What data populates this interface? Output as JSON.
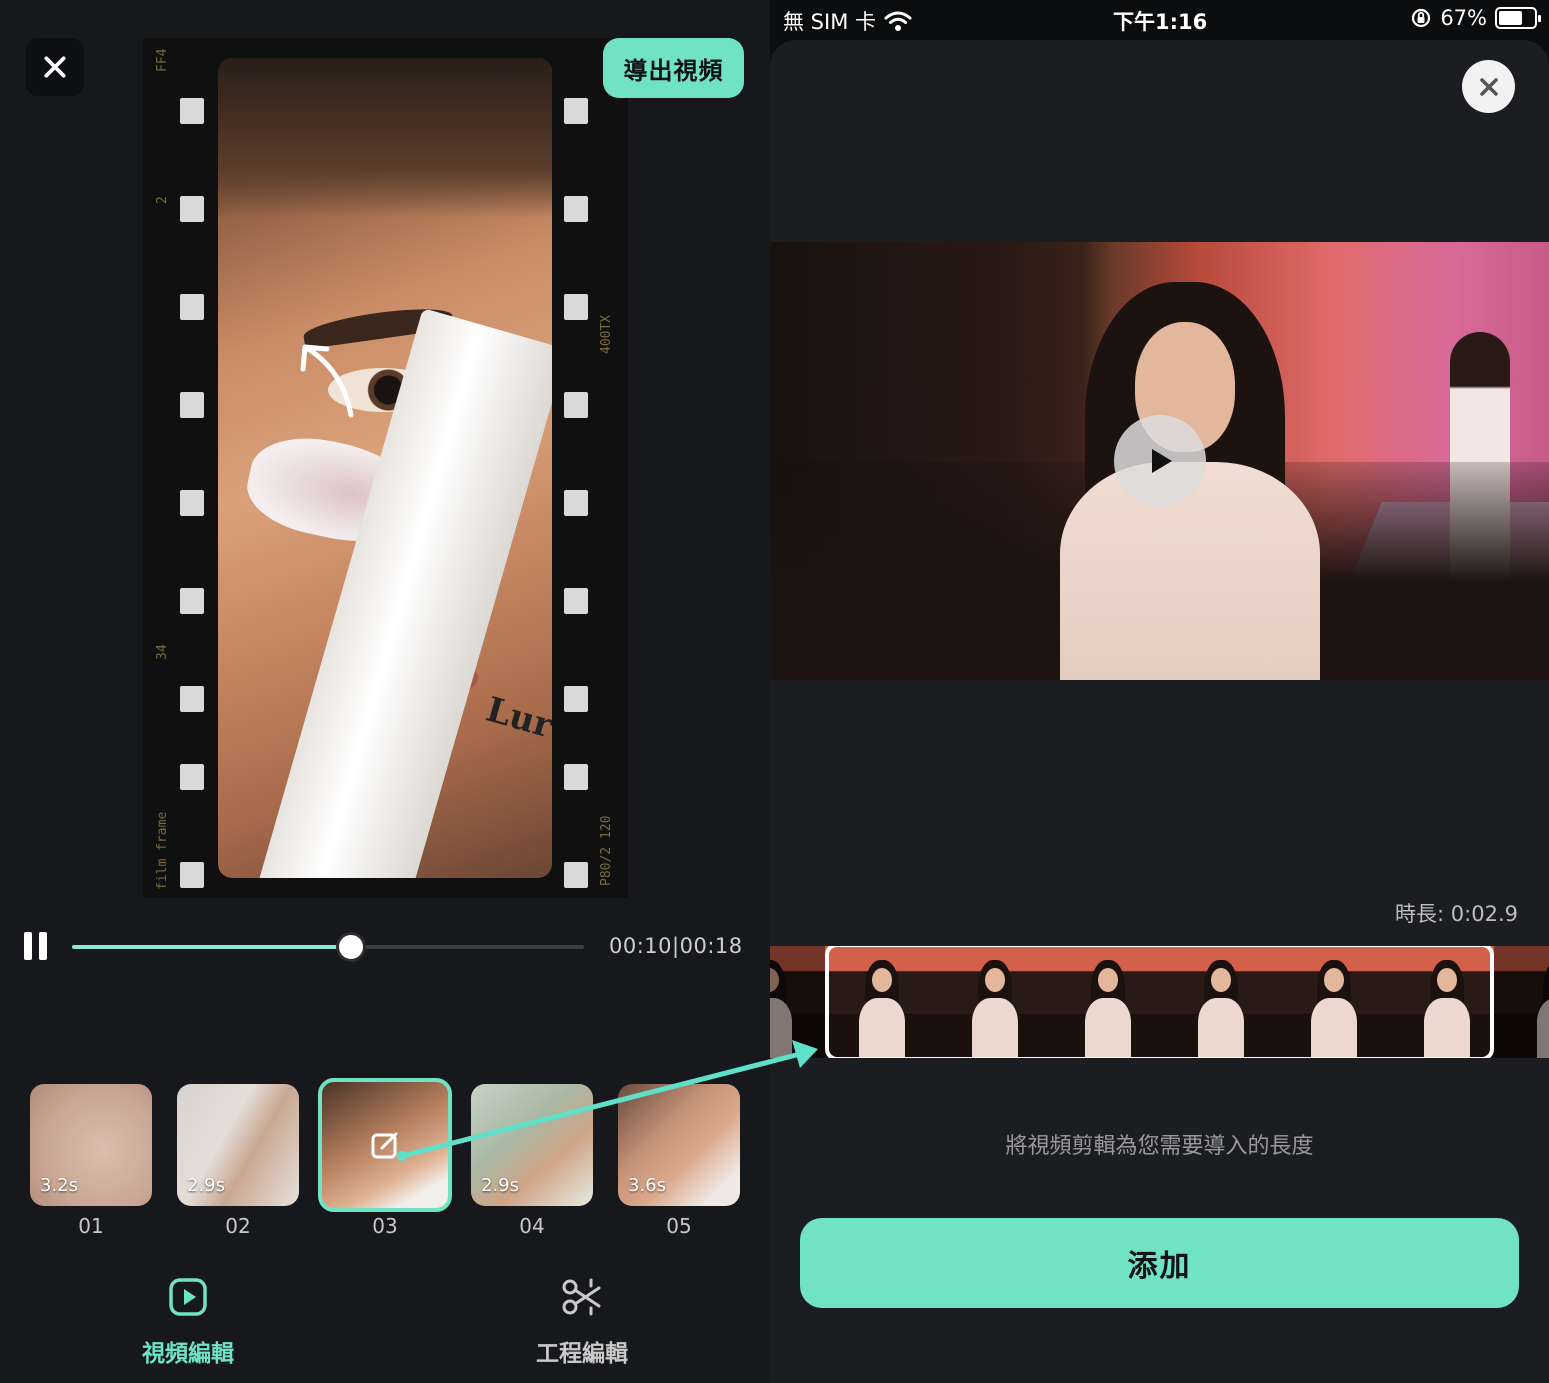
{
  "left": {
    "export_label": "導出視頻",
    "playback": {
      "current": "00:10",
      "total": "00:18",
      "separator": "|",
      "progress": 0.545
    },
    "clips": [
      {
        "num": "01",
        "duration": "3.2s",
        "active": false
      },
      {
        "num": "02",
        "duration": "2.9s",
        "active": false
      },
      {
        "num": "03",
        "duration": "",
        "active": true
      },
      {
        "num": "04",
        "duration": "2.9s",
        "active": false
      },
      {
        "num": "05",
        "duration": "3.6s",
        "active": false
      }
    ],
    "tabs": [
      {
        "label": "視頻編輯",
        "icon": "video-play-icon",
        "active": true
      },
      {
        "label": "工程編輯",
        "icon": "scissors-icon",
        "active": false
      }
    ],
    "film_edge": {
      "left_top": "FF4",
      "left_mid": "2",
      "left_low": "34",
      "left_bottom": "film frame",
      "right_mid": "400TX",
      "right_bottom": "P80/2 120"
    },
    "tube_text": "Lur"
  },
  "right": {
    "status": {
      "carrier": "無 SIM 卡",
      "time": "下午1:16",
      "battery": "67%",
      "battery_level": 0.67
    },
    "duration_label": "時長: 0:02.9",
    "hint": "將視頻剪輯為您需要導入的長度",
    "add_label": "添加"
  },
  "colors": {
    "accent": "#6fe3c3",
    "background": "#16181c",
    "sheet": "#1b1d21"
  }
}
